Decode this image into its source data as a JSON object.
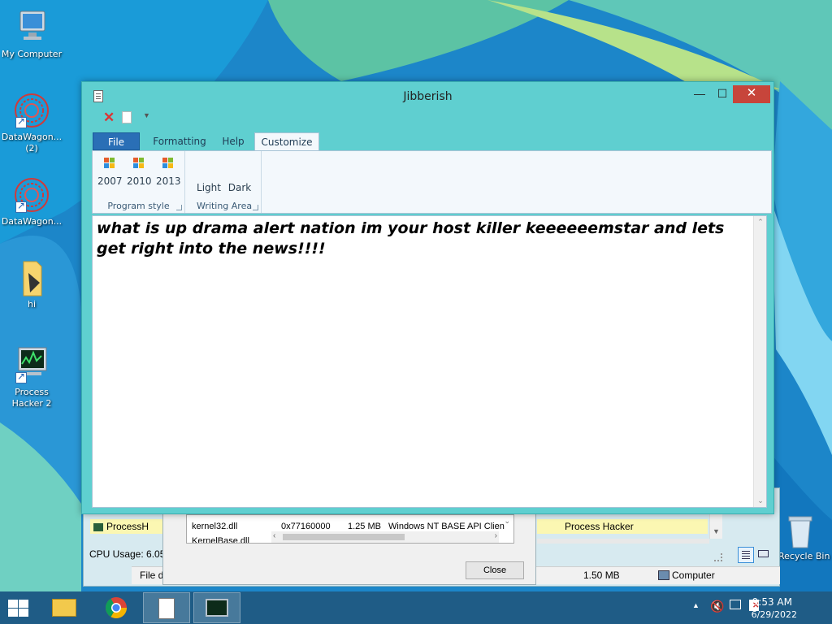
{
  "desktop": {
    "icons": [
      {
        "label": "My Computer"
      },
      {
        "label": "DataWagon...\n(2)"
      },
      {
        "label": "DataWagon..."
      },
      {
        "label": "hi"
      },
      {
        "label": "Process Hacker 2"
      },
      {
        "label": "Recycle Bin"
      }
    ]
  },
  "window": {
    "title": "Jibberish",
    "controls": {
      "minimize": "—",
      "maximize": "☐",
      "close": "✕"
    }
  },
  "ribbon": {
    "tabs": [
      {
        "label": "File"
      },
      {
        "label": "Formatting"
      },
      {
        "label": "Help"
      },
      {
        "label": "Customize"
      }
    ],
    "active_tab": "Customize",
    "groups": {
      "program_style": {
        "label": "Program style",
        "buttons": [
          "2007",
          "2010",
          "2013"
        ]
      },
      "writing_area": {
        "label": "Writing Area",
        "buttons": [
          "Light",
          "Dark"
        ]
      }
    }
  },
  "editor": {
    "text": "what is up drama alert nation im your host killer keeeeeemstar and lets get right into the news!!!!"
  },
  "background_window": {
    "item_left": "ProcessH",
    "item_right": "Process Hacker",
    "cpu_usage": "CPU Usage: 6.05",
    "status_file": "File d",
    "status_size": "1.50 MB",
    "status_computer": "Computer"
  },
  "modules_dialog": {
    "rows": [
      {
        "name": "kernel32.dll",
        "base": "0x77160000",
        "size": "1.25 MB",
        "desc": "Windows NT BASE API Clien"
      },
      {
        "name": "KernelBase.dll",
        "base": "",
        "size": "",
        "desc": ""
      }
    ],
    "close_label": "Close"
  },
  "taskbar": {
    "time": "9:53 AM",
    "date": "6/29/2022"
  },
  "colors": {
    "window_frame": "#5fcfd0",
    "close_red": "#c7453b",
    "file_tab_blue": "#2a6fb6",
    "taskbar": "#1f5c86"
  }
}
